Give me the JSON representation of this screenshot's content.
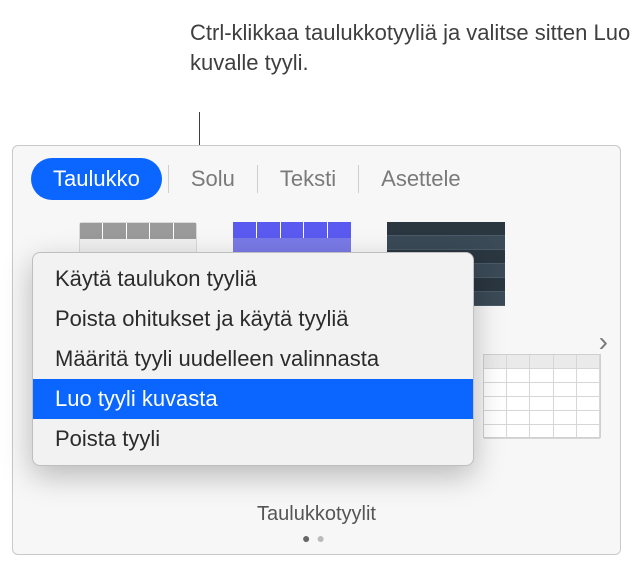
{
  "callout": {
    "text": "Ctrl-klikkaa taulukkotyyliä ja valitse sitten Luo kuvalle tyyli."
  },
  "tabs": {
    "active": "Taulukko",
    "items": [
      "Taulukko",
      "Solu",
      "Teksti",
      "Asettele"
    ]
  },
  "context_menu": {
    "items": [
      {
        "label": "Käytä taulukon tyyliä",
        "highlighted": false
      },
      {
        "label": "Poista ohitukset ja käytä tyyliä",
        "highlighted": false
      },
      {
        "label": "Määritä tyyli uudelleen valinnasta",
        "highlighted": false
      },
      {
        "label": "Luo tyyli kuvasta",
        "highlighted": true
      },
      {
        "label": "Poista tyyli",
        "highlighted": false
      }
    ]
  },
  "section": {
    "title": "Taulukkotyylit"
  }
}
